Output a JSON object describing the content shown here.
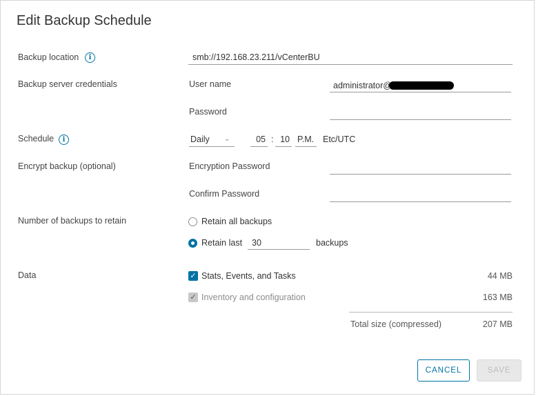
{
  "dialog": {
    "title": "Edit Backup Schedule"
  },
  "labels": {
    "backup_location": "Backup location",
    "backup_server_credentials": "Backup server credentials",
    "schedule": "Schedule",
    "encrypt_backup": "Encrypt backup (optional)",
    "number_of_backups": "Number of backups to retain",
    "data": "Data"
  },
  "backup_location": {
    "value": "smb://192.168.23.211/vCenterBU"
  },
  "credentials": {
    "username_label": "User name",
    "username_value": "administrator@",
    "password_label": "Password",
    "password_value": ""
  },
  "schedule": {
    "frequency": "Daily",
    "hour": "05",
    "separator": ":",
    "minute": "10",
    "ampm": "P.M.",
    "timezone": "Etc/UTC"
  },
  "encryption": {
    "password_label": "Encryption Password",
    "confirm_label": "Confirm Password"
  },
  "retention": {
    "retain_all_label": "Retain all backups",
    "retain_all_selected": false,
    "retain_last_label": "Retain last",
    "retain_last_selected": true,
    "retain_last_value": "30",
    "retain_last_suffix": "backups"
  },
  "data_items": [
    {
      "label": "Stats, Events, and Tasks",
      "size": "44 MB",
      "checked": true,
      "disabled": false
    },
    {
      "label": "Inventory and configuration",
      "size": "163 MB",
      "checked": true,
      "disabled": true
    }
  ],
  "total": {
    "label": "Total size (compressed)",
    "size": "207 MB"
  },
  "buttons": {
    "cancel": "CANCEL",
    "save": "SAVE"
  },
  "colors": {
    "accent": "#0072a3",
    "disabled_button_bg": "#e8e8e8"
  },
  "icons": {
    "info": "info-circle-icon",
    "checkmark": "checkmark-icon",
    "dropdown": "chevron-down-icon"
  }
}
